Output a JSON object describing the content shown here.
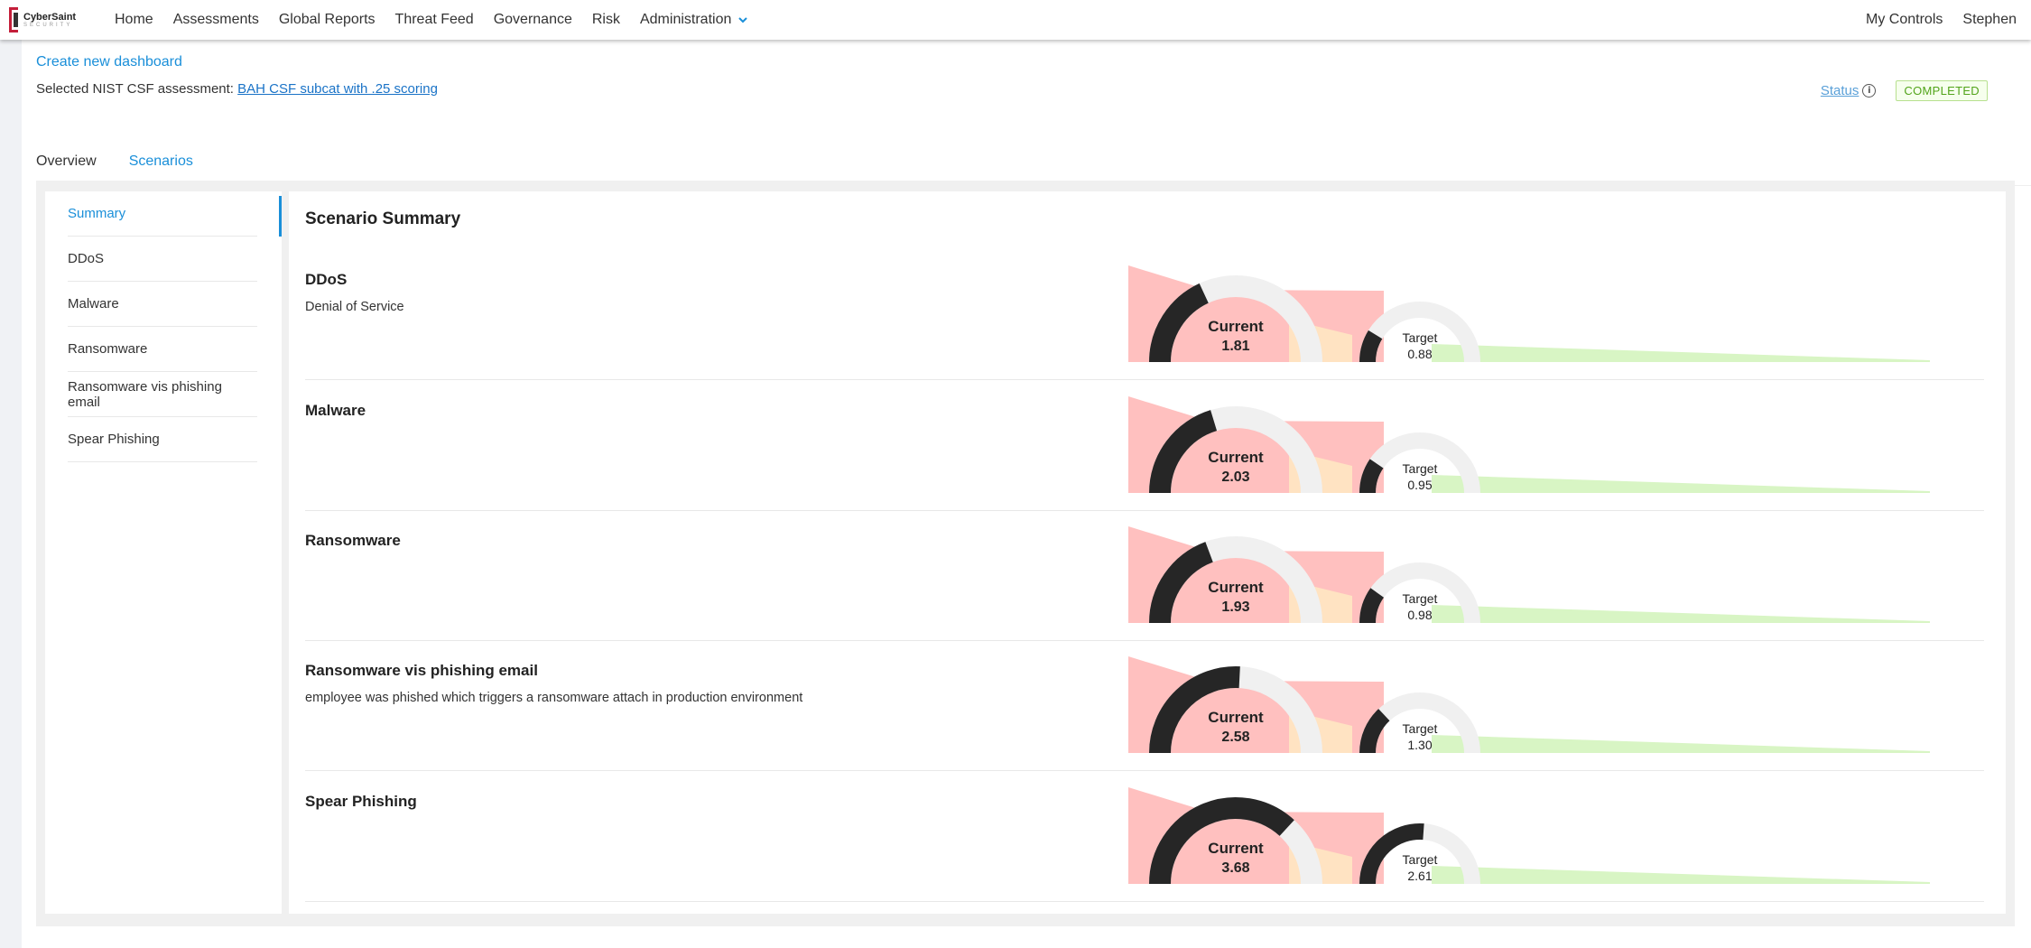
{
  "app": {
    "logo_line1": "CyberSaint",
    "logo_line2": "SECURITY"
  },
  "nav": {
    "items": [
      {
        "label": "Home"
      },
      {
        "label": "Assessments"
      },
      {
        "label": "Global Reports"
      },
      {
        "label": "Threat Feed"
      },
      {
        "label": "Governance"
      },
      {
        "label": "Risk"
      },
      {
        "label": "Administration"
      }
    ],
    "right": [
      {
        "label": "My Controls"
      },
      {
        "label": "Stephen"
      }
    ]
  },
  "header": {
    "create_link": "Create new dashboard",
    "assessment_prefix": "Selected NIST CSF assessment:",
    "assessment_link": "BAH CSF subcat with .25 scoring",
    "status_label": "Status",
    "status_badge": "COMPLETED"
  },
  "tabs": [
    {
      "label": "Overview",
      "active": false
    },
    {
      "label": "Scenarios",
      "active": true
    }
  ],
  "sidebar": {
    "items": [
      {
        "label": "Summary",
        "active": true
      },
      {
        "label": "DDoS"
      },
      {
        "label": "Malware"
      },
      {
        "label": "Ransomware"
      },
      {
        "label": "Ransomware vis phishing email"
      },
      {
        "label": "Spear Phishing"
      }
    ]
  },
  "main": {
    "title": "Scenario Summary",
    "current_label": "Current",
    "target_label": "Target",
    "gauge_max": 5,
    "scenarios": [
      {
        "name": "DDoS",
        "description": "Denial of Service",
        "current": 1.81,
        "current_text": "1.81",
        "target": 0.88,
        "target_text": "0.88"
      },
      {
        "name": "Malware",
        "description": "",
        "current": 2.03,
        "current_text": "2.03",
        "target": 0.95,
        "target_text": "0.95"
      },
      {
        "name": "Ransomware",
        "description": "",
        "current": 1.93,
        "current_text": "1.93",
        "target": 0.98,
        "target_text": "0.98"
      },
      {
        "name": "Ransomware vis phishing email",
        "description": "employee was phished which triggers a ransomware attach in production environment",
        "current": 2.58,
        "current_text": "2.58",
        "target": 1.3,
        "target_text": "1.30"
      },
      {
        "name": "Spear Phishing",
        "description": "",
        "current": 3.68,
        "current_text": "3.68",
        "target": 2.61,
        "target_text": "2.61"
      }
    ]
  },
  "colors": {
    "accent": "#1a8fd9",
    "risk_red": "#ffc0bf",
    "risk_orange": "#ffe3c2",
    "risk_green": "#d8f5c4",
    "gauge_fill": "#262626",
    "gauge_track": "#f0f0f0",
    "badge_green": "#52a41a"
  }
}
